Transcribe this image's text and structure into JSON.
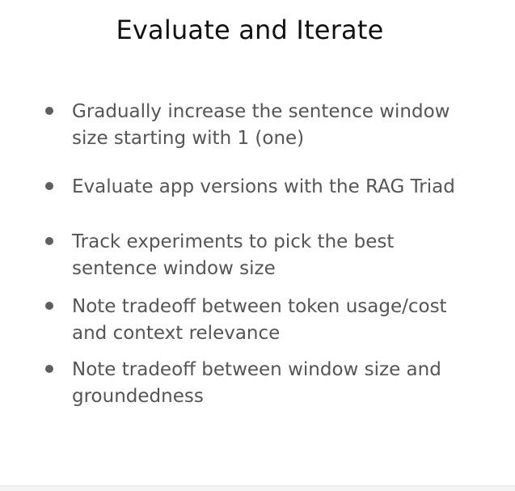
{
  "slide": {
    "title": "Evaluate and Iterate",
    "bullets": [
      "Gradually increase the sentence window size starting with 1 (one)",
      "Evaluate app versions with the RAG Triad",
      "Track experiments to pick the best sentence window size",
      "Note tradeoff between token usage/cost and context relevance",
      "Note tradeoff between window size and groundedness"
    ]
  },
  "colors": {
    "title": "#111111",
    "text": "#555555",
    "bullet_dot": "#5f5f5f",
    "background": "#ffffff"
  }
}
